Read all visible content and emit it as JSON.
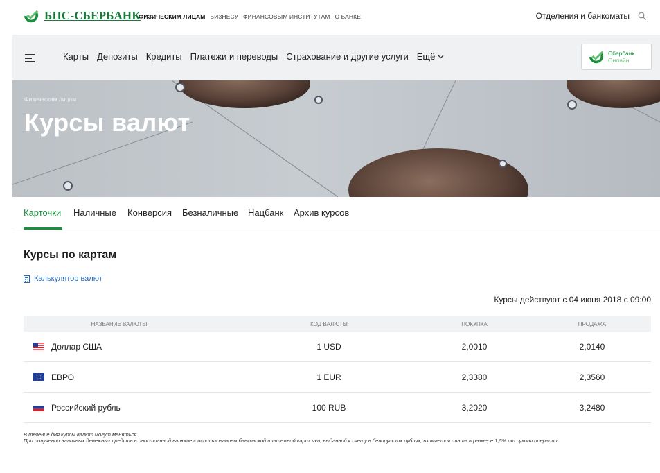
{
  "header": {
    "brand": "БПС-СБЕРБАНК",
    "top_nav": [
      {
        "label": "ФИЗИЧЕСКИМ ЛИЦАМ",
        "active": true
      },
      {
        "label": "БИЗНЕСУ",
        "active": false
      },
      {
        "label": "ФИНАНСОВЫМ ИНСТИТУТАМ",
        "active": false
      },
      {
        "label": "О БАНКЕ",
        "active": false
      }
    ],
    "branches_link": "Отделения и банкоматы"
  },
  "main_nav": {
    "items": [
      "Карты",
      "Депозиты",
      "Кредиты",
      "Платежи и переводы",
      "Страхование и другие услуги"
    ],
    "more_label": "Ещё",
    "online_button": {
      "line1": "Сбербанк",
      "line2": "Онлайн"
    }
  },
  "hero": {
    "breadcrumb": "Физическим лицам",
    "title": "Курсы валют"
  },
  "tabs": [
    {
      "label": "Карточки",
      "active": true
    },
    {
      "label": "Наличные",
      "active": false
    },
    {
      "label": "Конверсия",
      "active": false
    },
    {
      "label": "Безналичные",
      "active": false
    },
    {
      "label": "Нацбанк",
      "active": false
    },
    {
      "label": "Архив курсов",
      "active": false
    }
  ],
  "content": {
    "section_title": "Курсы по картам",
    "calculator_link": "Калькулятор валют",
    "rates_valid": "Курсы действуют с 04 июня 2018 с 09:00",
    "table": {
      "headers": [
        "НАЗВАНИЕ ВАЛЮТЫ",
        "КОД ВАЛЮТЫ",
        "ПОКУПКА",
        "ПРОДАЖА"
      ],
      "rows": [
        {
          "flag": "us-flag-icon",
          "name": "Доллар США",
          "code": "1 USD",
          "buy": "2,0010",
          "sell": "2,0140"
        },
        {
          "flag": "eu-flag-icon",
          "name": "ЕВРО",
          "code": "1 EUR",
          "buy": "2,3380",
          "sell": "2,3560"
        },
        {
          "flag": "ru-flag-icon",
          "name": "Российский рубль",
          "code": "100 RUB",
          "buy": "3,2020",
          "sell": "3,2480"
        }
      ]
    },
    "notes": [
      "В течение дня курсы валют могут меняться.",
      "При получении наличных денежных средств в иностранной валюте с использованием банковской платежной карточки, выданной к счету в белорусских рублях, взимается плата в размере 1,5% от суммы операции."
    ]
  },
  "colors": {
    "brand_green": "#1a8f3e",
    "link_blue": "#2568b8",
    "nav_bg": "#f0f1f3"
  }
}
